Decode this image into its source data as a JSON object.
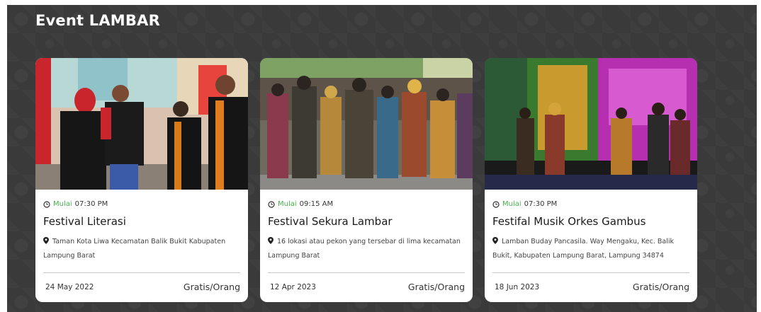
{
  "section": {
    "title": "Event LAMBAR"
  },
  "colors": {
    "background": "#3a3a3a",
    "accent_green": "#4caf50",
    "card": "#ffffff"
  },
  "events": [
    {
      "start_label": "Mulai",
      "start_time": "07:30 PM",
      "title": "Festival Literasi",
      "location": "Taman Kota Liwa Kecamatan Balik Bukit Kabupaten Lampung Barat",
      "date": "24 May 2022",
      "price": "Gratis/Orang"
    },
    {
      "start_label": "Mulai",
      "start_time": "09:15 AM",
      "title": "Festival Sekura Lambar",
      "location": "16 lokasi atau pekon yang tersebar di lima kecamatan Lampung Barat",
      "date": "12 Apr 2023",
      "price": "Gratis/Orang"
    },
    {
      "start_label": "Mulai",
      "start_time": "07:30 PM",
      "title": "Festifal Musik Orkes Gambus",
      "location": "Lamban Buday Pancasila. Way Mengaku, Kec. Balik Bukit, Kabupaten Lampung Barat, Lampung 34874",
      "date": "18 Jun 2023",
      "price": "Gratis/Orang"
    }
  ],
  "icons": {
    "time": "clock-icon",
    "location": "map-pin-icon"
  }
}
